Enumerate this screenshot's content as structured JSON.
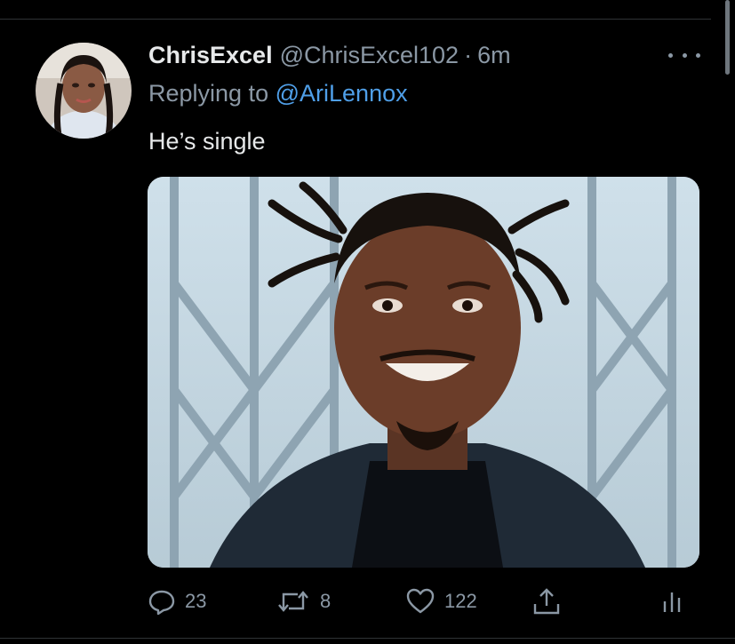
{
  "tweet": {
    "display_name": "ChrisExcel",
    "handle": "@ChrisExcel102",
    "separator": "·",
    "time": "6m",
    "replying_prefix": "Replying to",
    "replying_to": "@AriLennox",
    "text": "He’s single"
  },
  "actions": {
    "replies": "23",
    "retweets": "8",
    "likes": "122"
  },
  "colors": {
    "background": "#000000",
    "primary_text": "#e7e9ea",
    "secondary_text": "#8b98a5",
    "link": "#4f9fe8"
  },
  "icons": [
    "more-icon",
    "reply-icon",
    "retweet-icon",
    "like-icon",
    "share-icon",
    "analytics-icon"
  ]
}
